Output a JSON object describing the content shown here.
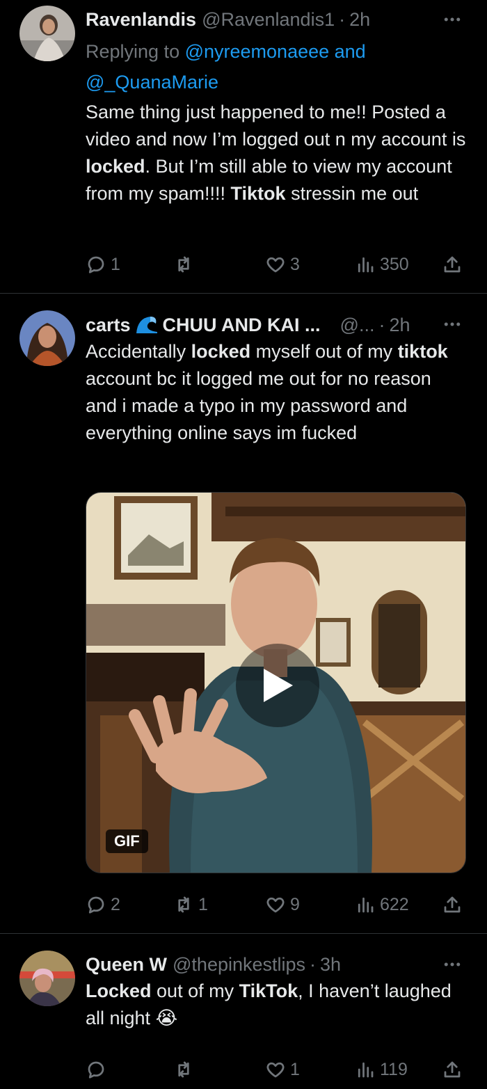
{
  "tweets": [
    {
      "name": "Ravenlandis",
      "handle": "@Ravenlandis1",
      "time": "2h",
      "reply_prefix": "Replying to ",
      "reply_mention_1": "@nyreemonaeee and",
      "reply_mention_2": "@_QuanaMarie",
      "text_parts": [
        "Same thing just happened to me!! Posted a video and now I’m logged out n my account is ",
        "locked",
        ". But I’m still able to view my account from my spam!!!! ",
        "Tiktok",
        " stressin me out"
      ],
      "replies": "1",
      "retweets": "",
      "likes": "3",
      "views": "350"
    },
    {
      "name": "carts",
      "name_suffix": "CHUU AND KAI ...",
      "handle": "@...",
      "time": "2h",
      "text_parts": [
        "Accidentally ",
        "locked",
        " myself out of my ",
        "tiktok",
        " account bc it logged me out for no reason and i made a typo in my password and everything online says im fucked"
      ],
      "media_badge": "GIF",
      "replies": "2",
      "retweets": "1",
      "likes": "9",
      "views": "622"
    },
    {
      "name": "Queen W",
      "handle": "@thepinkestlips",
      "time": "3h",
      "text_parts": [
        "Locked",
        " out of my ",
        "TikTok",
        ", I haven’t laughed all night ",
        "😭"
      ],
      "replies": "",
      "retweets": "",
      "likes": "1",
      "views": "119"
    }
  ],
  "colors": {
    "background": "#000000",
    "text": "#e7e9ea",
    "muted": "#71767b",
    "link": "#1d9bf0",
    "divider": "#2f3336"
  },
  "icons": [
    "reply-icon",
    "retweet-icon",
    "like-icon",
    "views-icon",
    "share-icon",
    "more-icon",
    "wave-emoji-icon",
    "crying-emoji-icon",
    "play-icon"
  ]
}
